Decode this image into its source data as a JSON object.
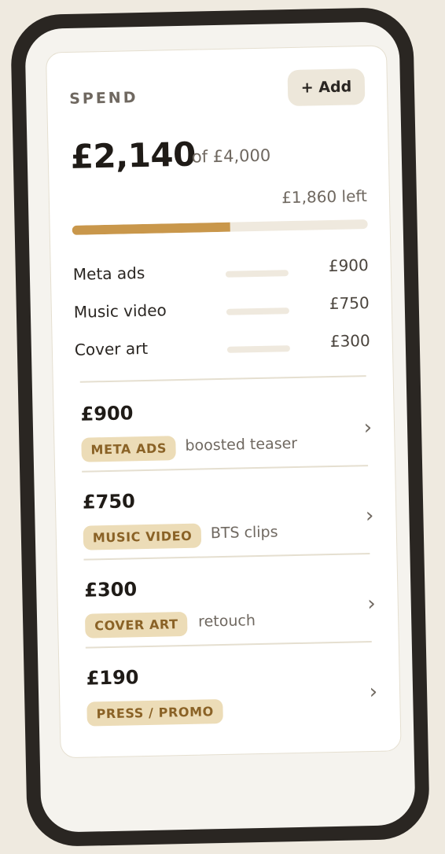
{
  "header": {
    "title": "SPEND",
    "add_label": "+ Add"
  },
  "budget": {
    "spent": "£2,140",
    "of_total": "of £4,000",
    "remaining": "£1,860 left",
    "progress_fraction": 0.535
  },
  "breakdown": [
    {
      "label": "Meta ads",
      "value": "£900"
    },
    {
      "label": "Music video",
      "value": "£750"
    },
    {
      "label": "Cover art",
      "value": "£300"
    }
  ],
  "transactions": [
    {
      "amount": "£900",
      "category": "META ADS",
      "note": "boosted teaser"
    },
    {
      "amount": "£750",
      "category": "MUSIC VIDEO",
      "note": "BTS clips"
    },
    {
      "amount": "£300",
      "category": "COVER ART",
      "note": "retouch"
    },
    {
      "amount": "£190",
      "category": "PRESS / PROMO",
      "note": ""
    }
  ],
  "icons": {
    "chevron": "chevron-right-icon"
  },
  "colors": {
    "accent": "#c9974b",
    "tag_bg": "#ecdcb7",
    "tag_text": "#8a6226",
    "frame": "#2a2622"
  }
}
